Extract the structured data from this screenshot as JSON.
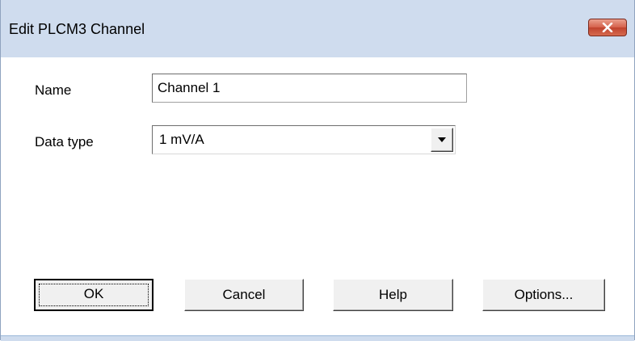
{
  "window": {
    "title": "Edit PLCM3 Channel",
    "close_icon": "close-icon",
    "close_color": "#c7422c"
  },
  "form": {
    "name_label": "Name",
    "name_value": "Channel 1",
    "data_type_label": "Data type",
    "data_type_value": "1 mV/A",
    "data_type_icon": "chevron-down-icon"
  },
  "buttons": {
    "ok": "OK",
    "cancel": "Cancel",
    "help": "Help",
    "options": "Options..."
  }
}
